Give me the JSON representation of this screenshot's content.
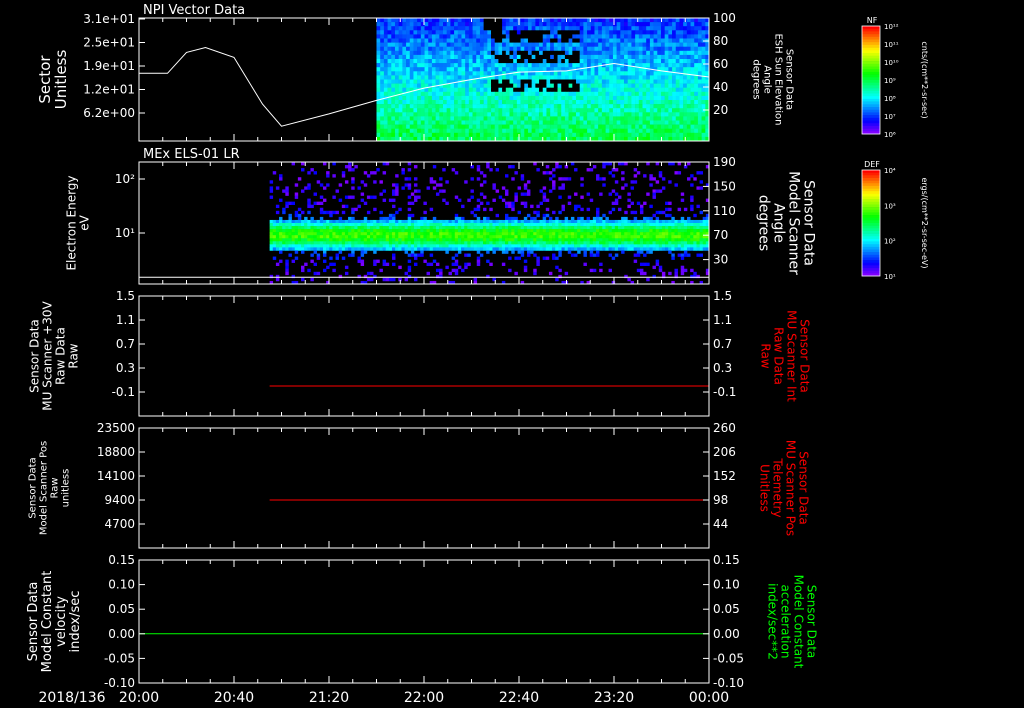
{
  "colors": {
    "background": "#000000",
    "axis": "#ffffff",
    "red": "#ff0000",
    "green": "#00ff00"
  },
  "time_axis": {
    "date_label": "2018/136",
    "ticks": [
      "20:00",
      "20:40",
      "21:20",
      "22:00",
      "22:40",
      "23:20",
      "00:00"
    ]
  },
  "colorbars": [
    {
      "tag": "NF",
      "unit": "cnts/(cm**2-sr-sec)",
      "ticks": [
        "10¹²",
        "10¹¹",
        "10¹⁰",
        "10⁹",
        "10⁸",
        "10⁷",
        "10⁶"
      ]
    },
    {
      "tag": "DEF",
      "unit": "ergs/(cm**2-sr-sec-eV)",
      "ticks": [
        "10⁴",
        "10³",
        "10²",
        "10¹"
      ]
    }
  ],
  "chart_data": [
    {
      "type": "heatmap",
      "title": "NPI Vector Data",
      "ylabel": [
        "Sector",
        "Unitless"
      ],
      "y_ticks": [
        "3.1e+01",
        "2.5e+01",
        "1.9e+01",
        "1.2e+01",
        "6.2e+00"
      ],
      "y2label": [
        "Sensor Data",
        "ESH Sun Elevation",
        "Angle",
        "degrees"
      ],
      "y2_ticks": [
        "100",
        "80",
        "60",
        "40",
        "20"
      ],
      "y2lim": [
        0,
        100
      ],
      "data_start_time": "21:40",
      "overlay_line": {
        "axis": "right",
        "x": [
          "20:00",
          "20:12",
          "20:20",
          "20:28",
          "20:40",
          "20:52",
          "21:00",
          "21:20",
          "21:40",
          "22:00",
          "22:20",
          "22:40",
          "23:00",
          "23:10",
          "23:20",
          "23:40",
          "24:00"
        ],
        "y": [
          55,
          55,
          72,
          76,
          68,
          30,
          12,
          22,
          33,
          43,
          50,
          56,
          57,
          60,
          63,
          57,
          52
        ]
      }
    },
    {
      "type": "heatmap",
      "title": "MEx ELS-01 LR",
      "ylabel": [
        "Electron Energy",
        "eV"
      ],
      "y_ticks": [
        "10²",
        "10¹"
      ],
      "y_scale": "log",
      "y2label": [
        "Sensor Data",
        "Model Scanner",
        "Angle",
        "degrees"
      ],
      "y2_ticks": [
        "190",
        "150",
        "110",
        "70",
        "30"
      ],
      "y2lim": [
        10,
        190
      ],
      "data_start_time": "20:55",
      "overlay_line": {
        "axis": "right",
        "constant": 20
      }
    },
    {
      "type": "line",
      "ylabel": [
        "Sensor Data",
        "MU Scanner +30V",
        "Raw Data",
        "Raw"
      ],
      "y_ticks": [
        "1.5",
        "1.1",
        "0.7",
        "0.3",
        "-0.1"
      ],
      "ylim": [
        -0.5,
        1.5
      ],
      "y2label": [
        "Sensor Data",
        "MU Scanner Int",
        "Raw Data",
        "Raw"
      ],
      "y2_ticks": [
        "1.5",
        "1.1",
        "0.7",
        "0.3",
        "-0.1"
      ],
      "y2lim": [
        -0.5,
        1.5
      ],
      "series": [
        {
          "color": "#ff0000",
          "axis": "right",
          "x_start": "20:55",
          "x_end": "24:00",
          "constant": 0.0
        }
      ]
    },
    {
      "type": "line",
      "ylabel": [
        "Sensor Data",
        "Model Scanner Pos",
        "Raw",
        "unitless"
      ],
      "y_ticks": [
        "23500",
        "18800",
        "14100",
        "9400",
        "4700"
      ],
      "ylim": [
        0,
        23500
      ],
      "y2label": [
        "Sensor Data",
        "MU Scanner Pos",
        "Telemetry",
        "Unitless"
      ],
      "y2_ticks": [
        "260",
        "206",
        "152",
        "98",
        "44"
      ],
      "y2lim": [
        -10,
        260
      ],
      "series": [
        {
          "color": "#ff0000",
          "axis": "right",
          "x_start": "20:55",
          "x_end": "24:00",
          "constant": 98
        }
      ]
    },
    {
      "type": "line",
      "ylabel": [
        "Sensor Data",
        "Model Constant",
        "velocity",
        "index/sec"
      ],
      "y_ticks": [
        "0.15",
        "0.10",
        "0.05",
        "0.00",
        "-0.05",
        "-0.10"
      ],
      "ylim": [
        -0.1,
        0.15
      ],
      "y2label": [
        "Sensor Data",
        "Model Constant",
        "acceleration",
        "index/sec**2"
      ],
      "y2_ticks": [
        "0.15",
        "0.10",
        "0.05",
        "0.00",
        "-0.05",
        "-0.10"
      ],
      "y2lim": [
        -0.1,
        0.15
      ],
      "series": [
        {
          "color": "#00ff00",
          "axis": "left",
          "x_start": "20:00",
          "x_end": "24:00",
          "constant": 0.0
        }
      ]
    }
  ]
}
